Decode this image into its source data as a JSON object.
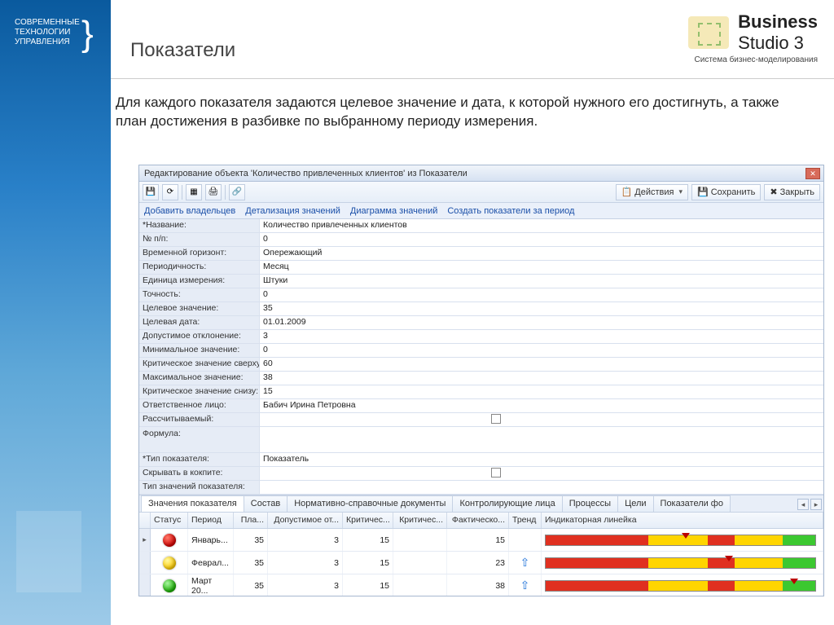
{
  "page": {
    "title": "Показатели",
    "intro": "Для каждого показателя задаются целевое значение и дата, к которой нужного его достигнуть, а также план достижения в разбивке по выбранному периоду измерения."
  },
  "leftLogo": {
    "l1": "СОВРЕМЕННЫЕ",
    "l2": "ТЕХНОЛОГИИ",
    "l3": "УПРАВЛЕНИЯ"
  },
  "rightLogo": {
    "brand": "Business",
    "brand2": "Studio 3",
    "sub": "Система бизнес-моделирования"
  },
  "window": {
    "title": "Редактирование объекта 'Количество привлеченных клиентов' из Показатели",
    "toolbar": {
      "actions": "Действия",
      "save": "Сохранить",
      "close": "Закрыть"
    },
    "links": {
      "addOwners": "Добавить владельцев",
      "detailValues": "Детализация значений",
      "diagram": "Диаграмма значений",
      "createPeriod": "Создать показатели за период"
    },
    "form": [
      {
        "label": "Название:",
        "value": "Количество привлеченных клиентов",
        "req": true
      },
      {
        "label": "№ п/п:",
        "value": "0"
      },
      {
        "label": "Временной горизонт:",
        "value": "Опережающий"
      },
      {
        "label": "Периодичность:",
        "value": "Месяц"
      },
      {
        "label": "Единица измерения:",
        "value": "Штуки"
      },
      {
        "label": "Точность:",
        "value": "0"
      },
      {
        "label": "Целевое значение:",
        "value": "35"
      },
      {
        "label": "Целевая дата:",
        "value": "01.01.2009"
      },
      {
        "label": "Допустимое отклонение:",
        "value": "3"
      },
      {
        "label": "Минимальное значение:",
        "value": "0"
      },
      {
        "label": "Критическое значение сверху:",
        "value": "60"
      },
      {
        "label": "Максимальное значение:",
        "value": "38"
      },
      {
        "label": "Критическое значение снизу:",
        "value": "15"
      },
      {
        "label": "Ответственное лицо:",
        "value": "Бабич Ирина Петровна"
      },
      {
        "label": "Рассчитываемый:",
        "value": "",
        "check": true
      },
      {
        "label": "Формула:",
        "value": "",
        "tall": true
      },
      {
        "label": "Тип показателя:",
        "value": "Показатель",
        "req": true
      },
      {
        "label": "Скрывать в кокпите:",
        "value": "",
        "check": true
      },
      {
        "label": "Тип значений показателя:",
        "value": ""
      }
    ],
    "tabs": [
      "Значения показателя",
      "Состав",
      "Нормативно-справочные документы",
      "Контролирующие лица",
      "Процессы",
      "Цели",
      "Показатели фо"
    ],
    "activeTab": 0,
    "grid": {
      "headers": {
        "status": "Статус",
        "period": "Период",
        "plan": "Пла...",
        "dev": "Допустимое от...",
        "crit": "Критичес...",
        "crit2": "Критичес...",
        "fact": "Фактическо...",
        "trend": "Тренд",
        "ind": "Индикаторная линейка"
      },
      "rows": [
        {
          "mark": "▸",
          "status": "red",
          "period": "Январь...",
          "plan": "35",
          "dev": "3",
          "crit": "15",
          "crit2": "",
          "fact": "15",
          "trend": "",
          "marker": 52
        },
        {
          "mark": "",
          "status": "yellow",
          "period": "Феврал...",
          "plan": "35",
          "dev": "3",
          "crit": "15",
          "crit2": "",
          "fact": "23",
          "trend": "up",
          "marker": 68
        },
        {
          "mark": "",
          "status": "green",
          "period": "Март 20...",
          "plan": "35",
          "dev": "3",
          "crit": "15",
          "crit2": "",
          "fact": "38",
          "trend": "up",
          "marker": 92
        }
      ]
    }
  }
}
